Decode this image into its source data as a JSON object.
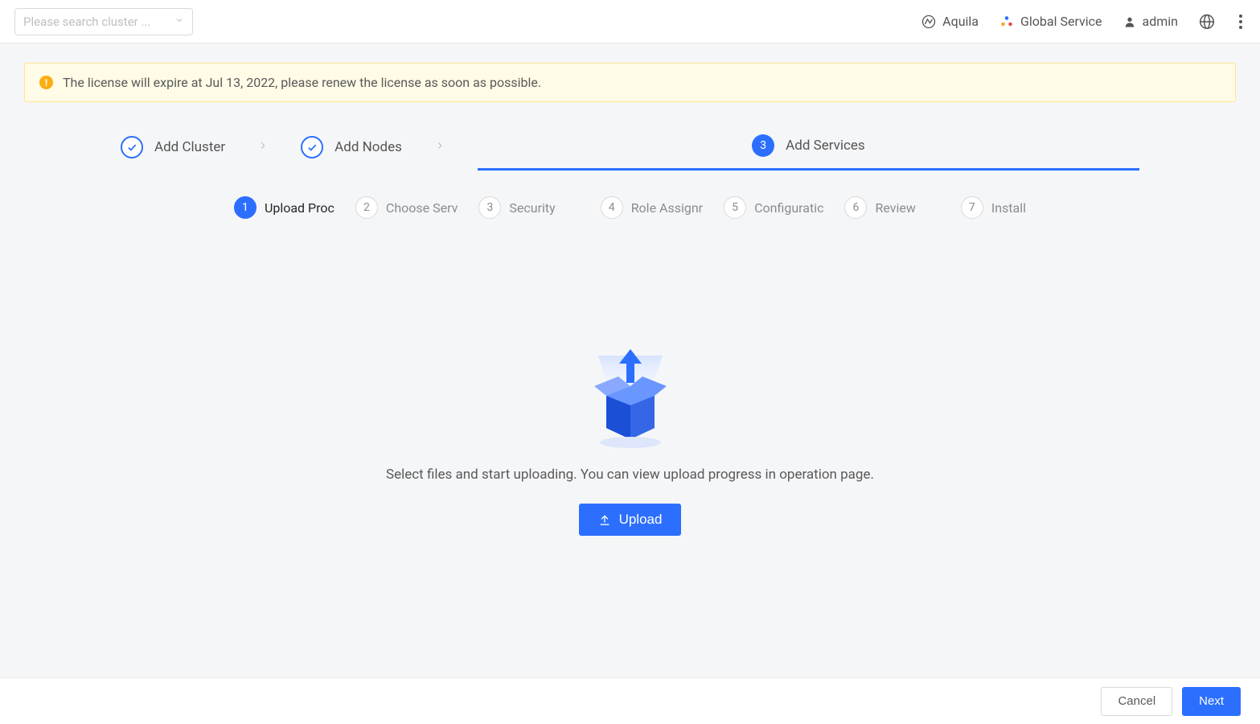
{
  "header": {
    "search_placeholder": "Please search cluster ...",
    "aquila": "Aquila",
    "global": "Global Service",
    "user": "admin"
  },
  "alert": {
    "text": "The license will expire at Jul 13, 2022, please renew the license as soon as possible."
  },
  "wizard": [
    {
      "label": "Add Cluster",
      "state": "done"
    },
    {
      "label": "Add Nodes",
      "state": "done"
    },
    {
      "label": "Add Services",
      "state": "current",
      "num": "3"
    }
  ],
  "substeps": [
    {
      "num": "1",
      "label": "Upload Proc",
      "active": true
    },
    {
      "num": "2",
      "label": "Choose Serv",
      "active": false
    },
    {
      "num": "3",
      "label": "Security",
      "active": false
    },
    {
      "num": "4",
      "label": "Role Assignr",
      "active": false
    },
    {
      "num": "5",
      "label": "Configuratic",
      "active": false
    },
    {
      "num": "6",
      "label": "Review",
      "active": false
    },
    {
      "num": "7",
      "label": "Install",
      "active": false
    }
  ],
  "main": {
    "instruction": "Select files and start uploading. You can view upload progress in operation page.",
    "upload_label": "Upload"
  },
  "footer": {
    "cancel": "Cancel",
    "next": "Next"
  }
}
